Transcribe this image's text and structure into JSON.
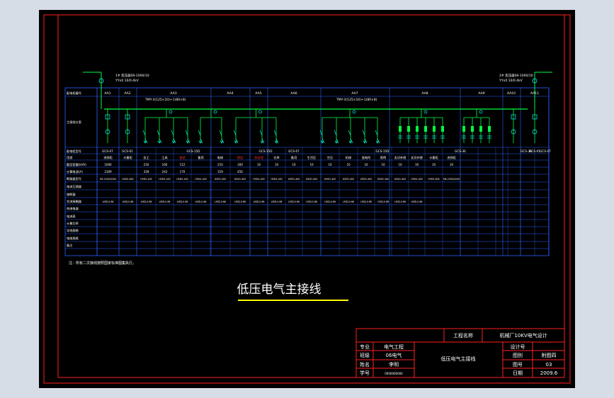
{
  "title": "低压电气主接线",
  "colors": {
    "background": "#000000",
    "border": "#ff2020",
    "grid": "#2a63ff",
    "busbar": "#00ff40",
    "device": "#00ffff",
    "text": "#ffffff",
    "title_text": "#ffffff",
    "underline": "#ffff00",
    "highlight": "#ff3030",
    "outer_bg": "#d7dde6"
  },
  "row_labels": [
    "配电柜编号",
    "主接线方案",
    "配电柜型号",
    "用途",
    "额定容量(kVA)",
    "计算电流(A)",
    "断路器型号",
    "电流互感器",
    "熔断器",
    "交流接触器",
    "热继电器",
    "电流表",
    "计算功率",
    "导线规格",
    "电缆规格",
    "备注"
  ],
  "cabinet_numbers": [
    "AA1",
    "AA2",
    "AA3",
    "AA4",
    "AA5",
    "AA6",
    "AA7",
    "AA8",
    "AA9",
    "AA10",
    "AA11"
  ],
  "cabinet_models": [
    "GCS-07",
    "GCS-01",
    "GCS-15D",
    "GCS-15D",
    "GCS-07",
    "GCS-15D",
    "GCS-36",
    "GCS-36",
    "GCS-01",
    "GCS-07"
  ],
  "uses": [
    "进线柜",
    "计量柜",
    "金工",
    "工具",
    "锻造",
    "备用",
    "电修",
    "铸造",
    "热处理",
    "仓库",
    "备用",
    "生活区",
    "空压",
    "机修",
    "变电所",
    "照明",
    "无功补偿",
    "无功补偿",
    "计量柜",
    "进线柜"
  ],
  "uses_highlight": [
    "锻造",
    "铸造",
    "热处理"
  ],
  "capacity": [
    "1600",
    "",
    "216",
    "160",
    "112",
    "",
    "210",
    "300",
    "",
    "",
    "",
    "",
    "",
    "",
    "",
    "",
    "",
    "",
    "",
    ""
  ],
  "current": [
    "2309",
    "",
    "328",
    "243",
    "170",
    "",
    "319",
    "456",
    "",
    "",
    "",
    "",
    "",
    "",
    "",
    "",
    "",
    "",
    "",
    ""
  ],
  "breaker_models": [
    "ME-2500/3200",
    "HSM1-800",
    "HSM1-400",
    "HSM1-400",
    "HSM1-400",
    "HSM1-400",
    "HSM1-400",
    "HSM1-400",
    "HSM1-400",
    "HSM1-400",
    "HSM1-400",
    "HSM1-400",
    "HSM1-400",
    "HSM1-400",
    "HSM1-400",
    "HSM1-400",
    "HSM1-400",
    "HSM1-400",
    "HSM1-800",
    "ME-2500/3200"
  ],
  "ct_values": [
    "LMZJ-0.66",
    "LMZJ-0.66",
    "LMZJ-0.66",
    "LMZJ-0.66",
    "LMZJ-0.66",
    "LMZJ-0.66",
    "LMZJ-0.66",
    "LMZJ-0.66",
    "LMZJ-0.66",
    "LMZJ-0.66",
    "LMZJ-0.66",
    "LMZJ-0.66",
    "LMZJ-0.66",
    "LMZJ-0.66",
    "LMZJ-0.66",
    "LMZJ-0.66",
    "LMZJ-0.66",
    "LMZJ-0.66"
  ],
  "capacitor_count": [
    "10",
    "10",
    "10",
    "10",
    "10",
    "10",
    "10",
    "10",
    "10",
    "10",
    "10",
    "10"
  ],
  "busbar_label_left": "TMY-3(125×10)+1(80×8)",
  "busbar_label_right": "TMY-3(125×10)+1(80×8)",
  "incoming_left": [
    "1# 变压器S9-1000/10",
    "YYn0 10/0.4kV"
  ],
  "incoming_right": [
    "2# 变压器S9-1000/10",
    "YYn0 10/0.4kV"
  ],
  "note": "注：所有二次接线按照国家标准图集执行。",
  "title_block": {
    "project_label": "工程名称",
    "project_value": "机械厂10KV电气设计",
    "rows": [
      {
        "label": "专业",
        "value": "电气工程"
      },
      {
        "label": "班级",
        "value": "06电气"
      },
      {
        "label": "姓名",
        "value": "李明"
      },
      {
        "label": "学号",
        "value": "0000000000"
      }
    ],
    "drawing_name": "低压电气主接线",
    "right_rows": [
      {
        "label": "设计号",
        "value": ""
      },
      {
        "label": "图别",
        "value": "附图四"
      },
      {
        "label": "图号",
        "value": "03"
      },
      {
        "label": "日期",
        "value": "2009.6"
      }
    ]
  }
}
